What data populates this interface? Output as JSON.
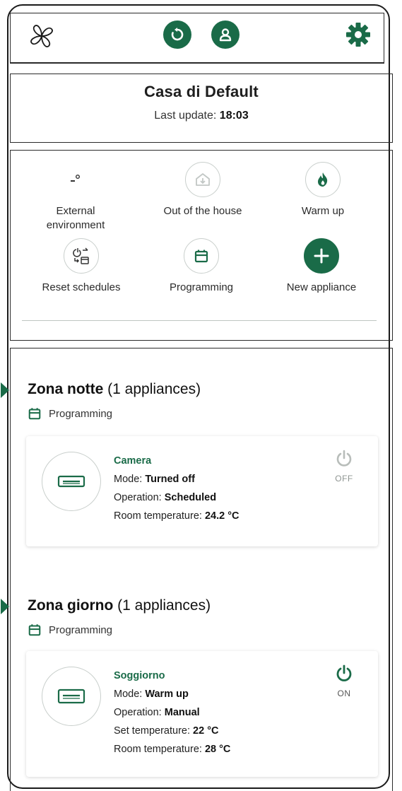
{
  "header": {
    "logo_icon": "fan-logo-icon",
    "refresh_icon": "refresh-icon",
    "user_icon": "user-icon",
    "settings_icon": "gear-icon"
  },
  "house": {
    "name": "Casa di Default",
    "last_update_label": "Last update:",
    "last_update_time": "18:03"
  },
  "actions": [
    {
      "label_line1": "External",
      "label_line2": "environment",
      "icon": "outside-temperature-icon"
    },
    {
      "label_line1": "Out of the house",
      "label_line2": "",
      "icon": "house-away-icon"
    },
    {
      "label_line1": "Warm up",
      "label_line2": "",
      "icon": "flame-icon"
    },
    {
      "label_line1": "Reset schedules",
      "label_line2": "",
      "icon": "reset-schedule-icon"
    },
    {
      "label_line1": "Programming",
      "label_line2": "",
      "icon": "calendar-icon"
    },
    {
      "label_line1": "New appliance",
      "label_line2": "",
      "icon": "plus-icon"
    }
  ],
  "zones": [
    {
      "name": "Zona notte",
      "count_text": "(1 appliances)",
      "mode": "Programming",
      "device": {
        "name": "Camera",
        "mode_label": "Mode:",
        "mode_value": "Turned off",
        "operation_label": "Operation:",
        "operation_value": "Scheduled",
        "room_temp_label": "Room temperature:",
        "room_temp_value": "24.2 °C",
        "power_state": "OFF"
      }
    },
    {
      "name": "Zona giorno",
      "count_text": "(1 appliances)",
      "mode": "Programming",
      "device": {
        "name": "Soggiorno",
        "mode_label": "Mode:",
        "mode_value": "Warm up",
        "operation_label": "Operation:",
        "operation_value": "Manual",
        "set_temp_label": "Set temperature:",
        "set_temp_value": "22 °C",
        "room_temp_label": "Room temperature:",
        "room_temp_value": "28 °C",
        "power_state": "ON"
      }
    }
  ],
  "colors": {
    "accent": "#1a6b48",
    "power_on": "#1a6b48",
    "power_off": "#b8bdba"
  }
}
